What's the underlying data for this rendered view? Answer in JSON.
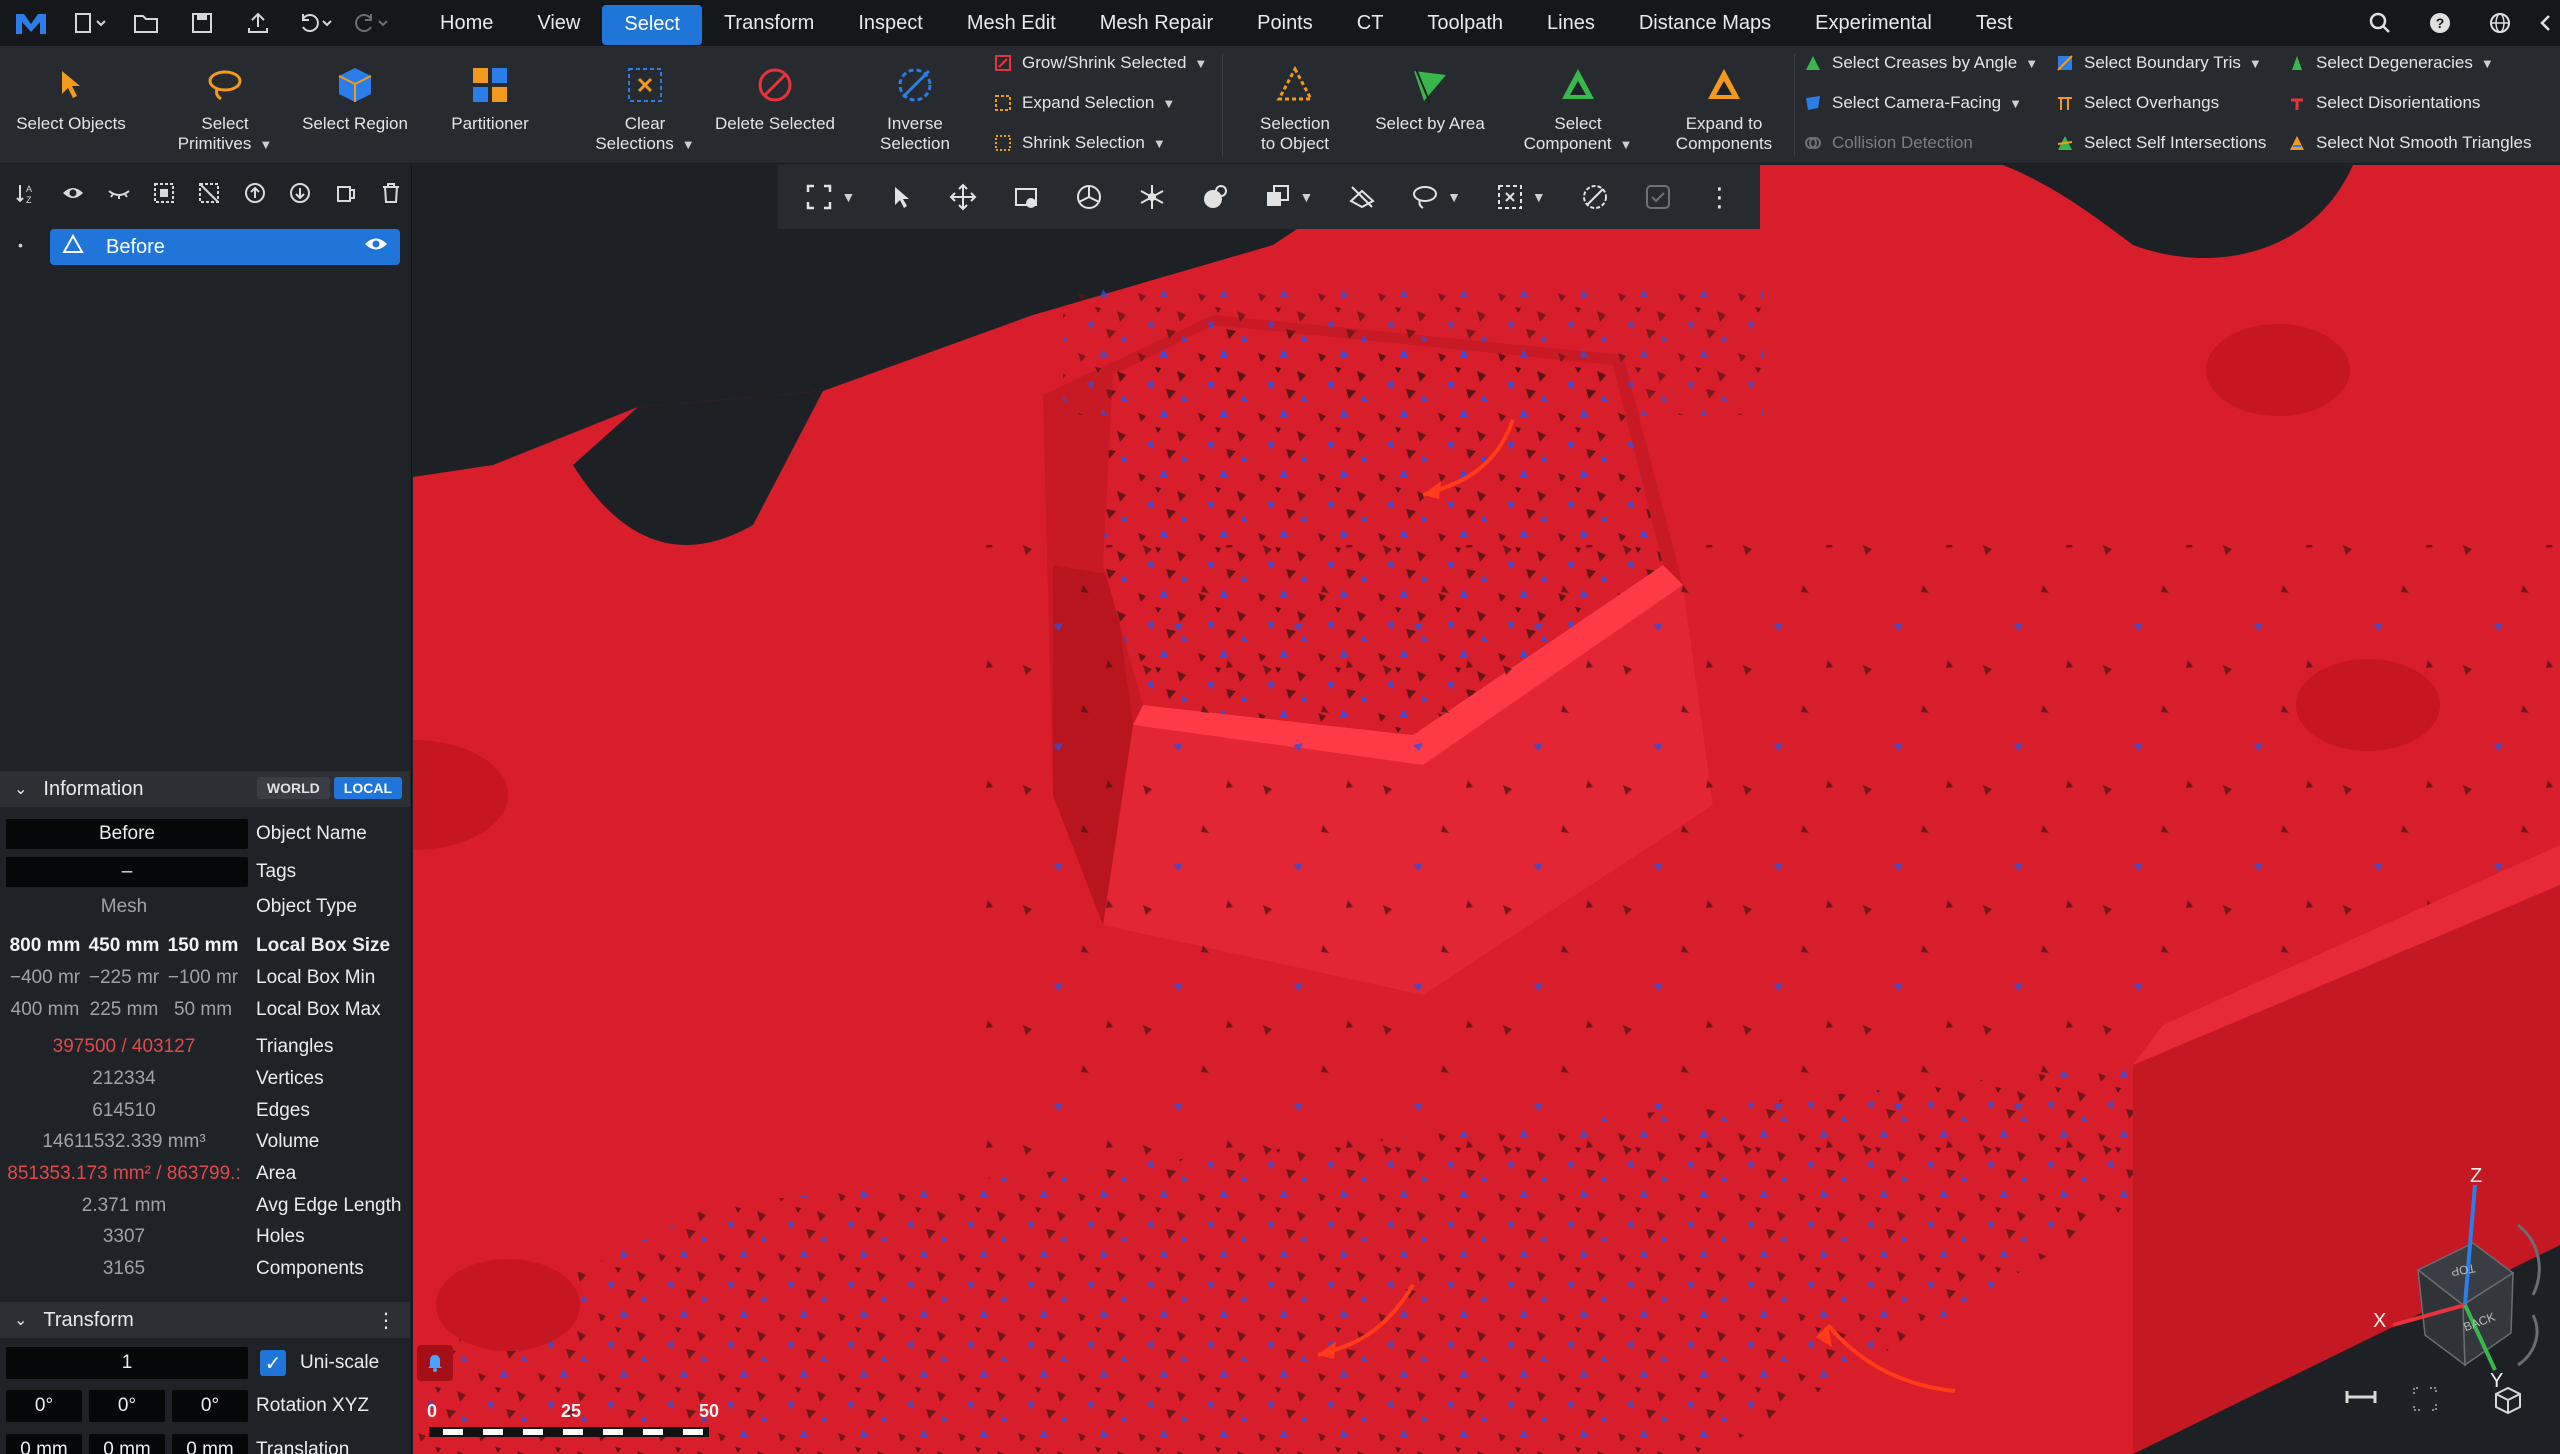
{
  "menubar": {
    "tabs": [
      "Home",
      "View",
      "Select",
      "Transform",
      "Inspect",
      "Mesh Edit",
      "Mesh Repair",
      "Points",
      "CT",
      "Toolpath",
      "Lines",
      "Distance Maps",
      "Experimental",
      "Test"
    ],
    "active_tab": "Select"
  },
  "ribbon": {
    "select_objects": "Select Objects",
    "select_primitives_1": "Select",
    "select_primitives_2": "Primitives",
    "select_region": "Select Region",
    "partitioner": "Partitioner",
    "clear_selections_1": "Clear",
    "clear_selections_2": "Selections",
    "delete_selected": "Delete Selected",
    "inverse_selection_1": "Inverse",
    "inverse_selection_2": "Selection",
    "grow_shrink_selected": "Grow/Shrink Selected",
    "expand_selection": "Expand Selection",
    "shrink_selection": "Shrink Selection",
    "selection_to_object_1": "Selection",
    "selection_to_object_2": "to Object",
    "select_by_area": "Select by Area",
    "select_component_1": "Select",
    "select_component_2": "Component",
    "expand_to_components_1": "Expand to",
    "expand_to_components_2": "Components",
    "select_creases_by_angle": "Select Creases by Angle",
    "select_camera_facing": "Select Camera-Facing",
    "collision_detection": "Collision Detection",
    "select_boundary_tris": "Select Boundary Tris",
    "select_overhangs": "Select Overhangs",
    "select_self_intersections": "Select Self Intersections",
    "select_degeneracies": "Select Degeneracies",
    "select_disorientations": "Select Disorientations",
    "select_not_smooth_triangles": "Select Not Smooth Triangles"
  },
  "tree": {
    "item_label": "Before"
  },
  "information": {
    "title": "Information",
    "world": "WORLD",
    "local": "LOCAL",
    "object_name_value": "Before",
    "object_name_key": "Object Name",
    "tags_value": "–",
    "tags_key": "Tags",
    "object_type_value": "Mesh",
    "object_type_key": "Object Type",
    "box_size": [
      "800 mm",
      "450 mm",
      "150 mm"
    ],
    "box_size_key": "Local Box Size",
    "box_min": [
      "−400 mr",
      "−225 mr",
      "−100 mr"
    ],
    "box_min_key": "Local Box Min",
    "box_max": [
      "400 mm",
      "225 mm",
      "50 mm"
    ],
    "box_max_key": "Local Box Max",
    "triangles_value": "397500 / 403127",
    "triangles_key": "Triangles",
    "vertices_value": "212334",
    "vertices_key": "Vertices",
    "edges_value": "614510",
    "edges_key": "Edges",
    "volume_value": "14611532.339 mm³",
    "volume_key": "Volume",
    "area_value": "851353.173 mm² / 863799.:",
    "area_key": "Area",
    "avg_edge_value": "2.371 mm",
    "avg_edge_key": "Avg Edge Length",
    "holes_value": "3307",
    "holes_key": "Holes",
    "components_value": "3165",
    "components_key": "Components"
  },
  "transform": {
    "title": "Transform",
    "scale_value": "1",
    "uniscale_label": "Uni-scale",
    "rotation": [
      "0°",
      "0°",
      "0°"
    ],
    "rotation_key": "Rotation XYZ",
    "translation": [
      "0 mm",
      "0 mm",
      "0 mm"
    ],
    "translation_key": "Translation"
  },
  "viewport": {
    "scale_labels": [
      "0",
      "25",
      "50"
    ],
    "axis_z": "Z",
    "axis_x": "X",
    "axis_y": "Y",
    "cube_top": "TOP",
    "cube_back": "BACK"
  },
  "colors": {
    "accent": "#1f75d8",
    "mesh_red": "#d81e2a",
    "selected_blue": "#2f4fe0",
    "dark_spots": "#5a1414"
  }
}
